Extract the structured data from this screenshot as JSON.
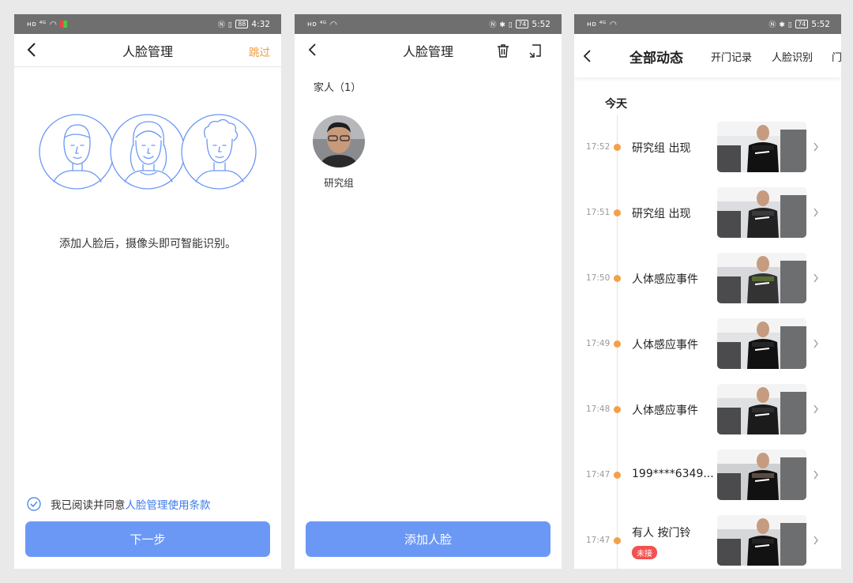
{
  "status_left": {
    "screen1": {
      "time": "4:32",
      "battery": "88"
    },
    "screen2": {
      "time": "5:52",
      "battery": "74"
    },
    "screen3": {
      "time": "5:52",
      "battery": "74"
    }
  },
  "screen1": {
    "title": "人脸管理",
    "skip": "跳过",
    "intro": "添加人脸后，摄像头即可智能识别。",
    "agree_prefix": "我已阅读并同意",
    "agree_link": "人脸管理使用条款",
    "next_button": "下一步"
  },
  "screen2": {
    "title": "人脸管理",
    "group_label": "家人（1）",
    "face_name": "研究组",
    "add_button": "添加人脸"
  },
  "screen3": {
    "tabs": [
      "全部动态",
      "开门记录",
      "人脸识别",
      "门"
    ],
    "section": "今天",
    "events": [
      {
        "time": "17:52",
        "title": "研究组 出现"
      },
      {
        "time": "17:51",
        "title": "研究组 出现"
      },
      {
        "time": "17:50",
        "title": "人体感应事件"
      },
      {
        "time": "17:49",
        "title": "人体感应事件"
      },
      {
        "time": "17:48",
        "title": "人体感应事件"
      },
      {
        "time": "17:47",
        "title": "199****6349..."
      },
      {
        "time": "17:47",
        "title": "有人 按门铃",
        "badge": "未接"
      }
    ]
  },
  "colors": {
    "accent_orange": "#f39a3d",
    "primary_blue": "#6c98f5",
    "link_blue": "#3b7be8",
    "badge_red": "#f25250"
  }
}
